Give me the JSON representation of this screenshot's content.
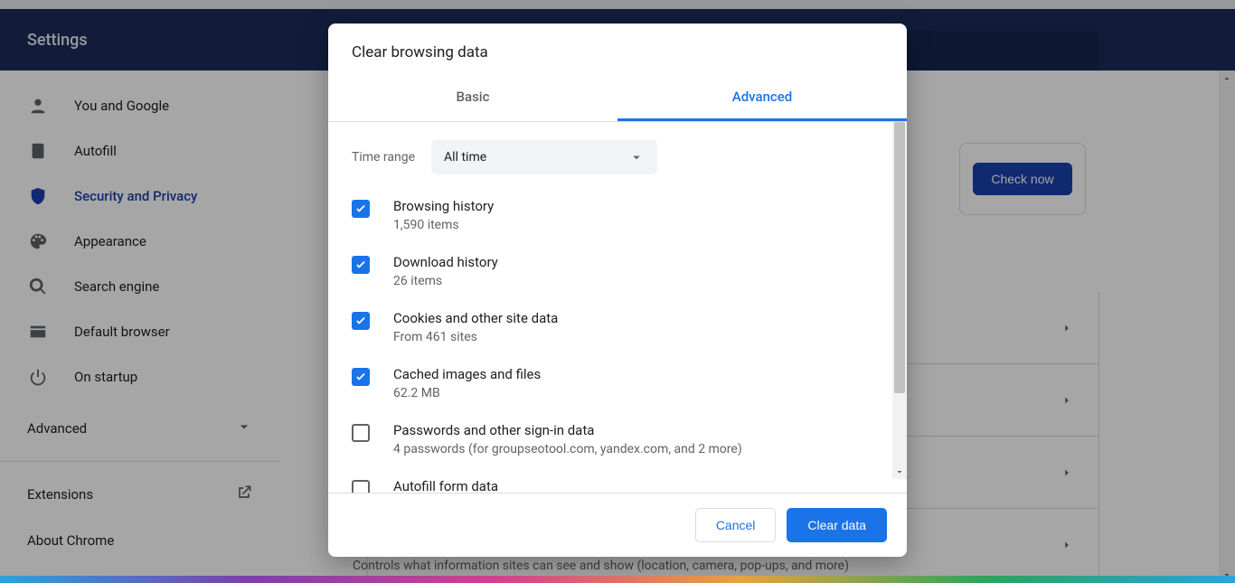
{
  "header": {
    "title": "Settings"
  },
  "sidebar": {
    "items": [
      {
        "label": "You and Google"
      },
      {
        "label": "Autofill"
      },
      {
        "label": "Security and Privacy"
      },
      {
        "label": "Appearance"
      },
      {
        "label": "Search engine"
      },
      {
        "label": "Default browser"
      },
      {
        "label": "On startup"
      }
    ],
    "advanced": "Advanced",
    "extensions": "Extensions",
    "about": "About Chrome"
  },
  "content": {
    "check_now": "Check now",
    "footer_text": "Controls what information sites can see and show (location, camera, pop-ups, and more)"
  },
  "dialog": {
    "title": "Clear browsing data",
    "tabs": {
      "basic": "Basic",
      "advanced": "Advanced"
    },
    "time_label": "Time range",
    "time_value": "All time",
    "options": [
      {
        "title": "Browsing history",
        "sub": "1,590 items",
        "checked": true
      },
      {
        "title": "Download history",
        "sub": "26 items",
        "checked": true
      },
      {
        "title": "Cookies and other site data",
        "sub": "From 461 sites",
        "checked": true
      },
      {
        "title": "Cached images and files",
        "sub": "62.2 MB",
        "checked": true
      },
      {
        "title": "Passwords and other sign-in data",
        "sub": "4 passwords (for groupseotool.com, yandex.com, and 2 more)",
        "checked": false
      },
      {
        "title": "Autofill form data",
        "sub": "",
        "checked": false
      }
    ],
    "cancel": "Cancel",
    "clear": "Clear data"
  }
}
